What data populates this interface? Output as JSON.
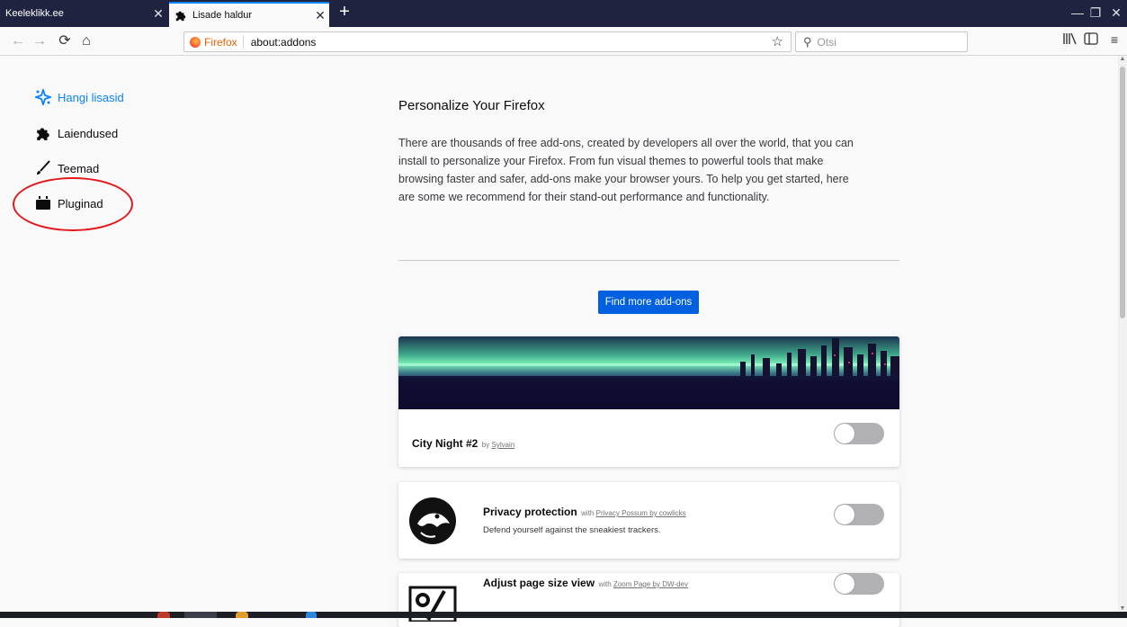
{
  "browser": {
    "tabs": [
      {
        "title": "Keeleklikk.ee",
        "active": false
      },
      {
        "title": "Lisade haldur",
        "active": true
      }
    ],
    "url_identity": "Firefox",
    "url": "about:addons",
    "search_placeholder": "Otsi",
    "accent_color": "#0a84ff",
    "tabstrip_color": "#202340"
  },
  "sidebar": {
    "items": [
      {
        "label": "Hangi lisasid",
        "icon": "sparkle-icon",
        "selected": true
      },
      {
        "label": "Laiendused",
        "icon": "puzzle-icon",
        "selected": false
      },
      {
        "label": "Teemad",
        "icon": "brush-icon",
        "selected": false
      },
      {
        "label": "Pluginad",
        "icon": "plugin-icon",
        "selected": false
      }
    ]
  },
  "main": {
    "heading": "Personalize Your Firefox",
    "intro": "There are thousands of free add-ons, created by developers all over the world, that you can install to personalize your Firefox. From fun visual themes to powerful tools that make browsing faster and safer, add-ons make your browser yours. To help you get started, here are some we recommend for their stand-out performance and functionality.",
    "find_button": "Find more add-ons",
    "find_button_color": "#0060df",
    "cards": [
      {
        "name": "City Night #2",
        "by_prefix": "by",
        "author": "Sylvain",
        "description": "",
        "enabled": false
      },
      {
        "name": "Privacy protection",
        "by_prefix": "with",
        "author": "Privacy Possum by cowlicks",
        "description": "Defend yourself against the sneakiest trackers.",
        "enabled": false
      },
      {
        "name": "Adjust page size view",
        "by_prefix": "with",
        "author": "Zoom Page by DW-dev",
        "description": "",
        "enabled": false
      }
    ]
  },
  "annotation_color": "#e3191c"
}
